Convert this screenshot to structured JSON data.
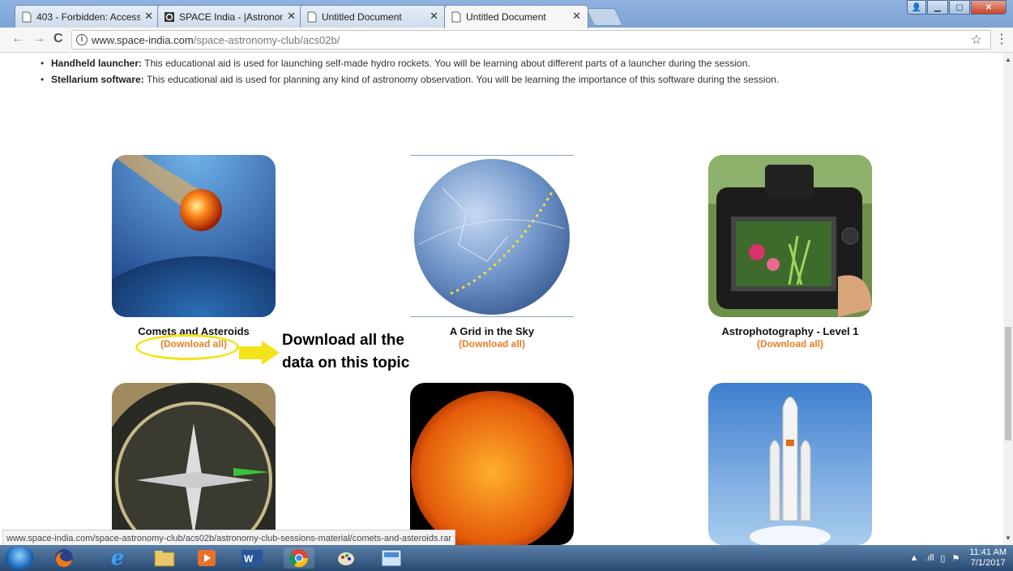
{
  "browser": {
    "tabs": [
      {
        "title": "403 - Forbidden: Access"
      },
      {
        "title": "SPACE India - |Astronom"
      },
      {
        "title": "Untitled Document"
      },
      {
        "title": "Untitled Document"
      }
    ],
    "url_host": "www.space-india.com",
    "url_path": "/space-astronomy-club/acs02b/",
    "status_url": "www.space-india.com/space-astronomy-club/acs02b/astronomy-club-sessions-material/comets-and-asteroids.rar"
  },
  "content": {
    "bullets": [
      {
        "term": "Handheld launcher:",
        "text": " This educational aid is used for launching self-made hydro rockets. You will be learning about different parts of a launcher during the session."
      },
      {
        "term": "Stellarium software:",
        "text": " This educational aid is used for planning any kind of astronomy observation. You will be learning the importance of this software during the session."
      }
    ],
    "cards": [
      {
        "title": "Comets and Asteroids",
        "download": "(Download all)"
      },
      {
        "title": "A Grid in the Sky",
        "download": "(Download all)"
      },
      {
        "title": "Astrophotography - Level 1",
        "download": "(Download all)"
      }
    ],
    "annotation": {
      "line1": "Download all the",
      "line2": "data on this topic"
    }
  },
  "taskbar": {
    "time": "11:41 AM",
    "date": "7/1/2017"
  },
  "colors": {
    "download_link": "#e87f24",
    "highlight": "#f3e41a"
  }
}
